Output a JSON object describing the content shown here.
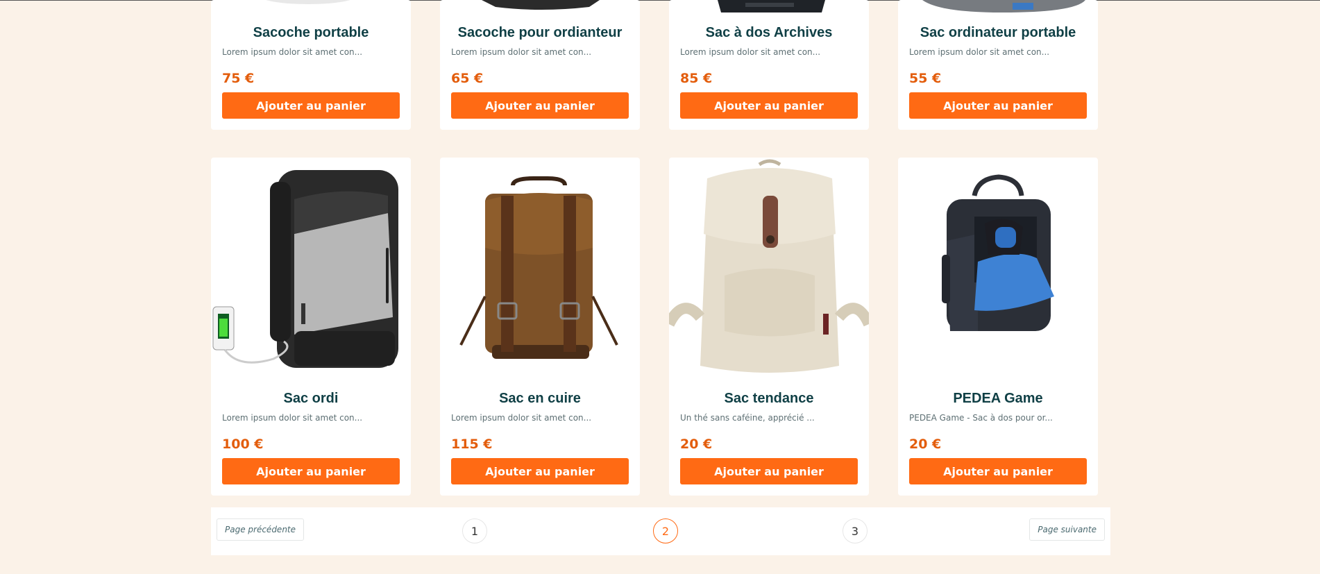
{
  "products_row1": [
    {
      "title": "Sacoche portable",
      "desc": "Lorem ipsum dolor sit amet con...",
      "price": "75 €",
      "button": "Ajouter au panier"
    },
    {
      "title": "Sacoche pour ordianteur",
      "desc": "Lorem ipsum dolor sit amet con...",
      "price": "65 €",
      "button": "Ajouter au panier"
    },
    {
      "title": "Sac à dos Archives",
      "desc": "Lorem ipsum dolor sit amet con...",
      "price": "85 €",
      "button": "Ajouter au panier"
    },
    {
      "title": "Sac ordinateur portable",
      "desc": "Lorem ipsum dolor sit amet con...",
      "price": "55 €",
      "button": "Ajouter au panier"
    }
  ],
  "products_row2": [
    {
      "title": "Sac ordi",
      "desc": "Lorem ipsum dolor sit amet con...",
      "price": "100 €",
      "button": "Ajouter au panier"
    },
    {
      "title": "Sac en cuire",
      "desc": "Lorem ipsum dolor sit amet con...",
      "price": "115 €",
      "button": "Ajouter au panier"
    },
    {
      "title": "Sac tendance",
      "desc": "Un thé sans caféine, apprécié ...",
      "price": "20 €",
      "button": "Ajouter au panier"
    },
    {
      "title": "PEDEA Game",
      "desc": "PEDEA Game - Sac à dos pour or...",
      "price": "20 €",
      "button": "Ajouter au panier"
    }
  ],
  "pagination": {
    "prev": "Page précédente",
    "next": "Page suivante",
    "pages": [
      "1",
      "2",
      "3"
    ],
    "current": "2"
  },
  "colors": {
    "accent": "#ff6a14",
    "price": "#e35d0c",
    "title": "#0f3f45",
    "background": "#fbf2e8"
  }
}
